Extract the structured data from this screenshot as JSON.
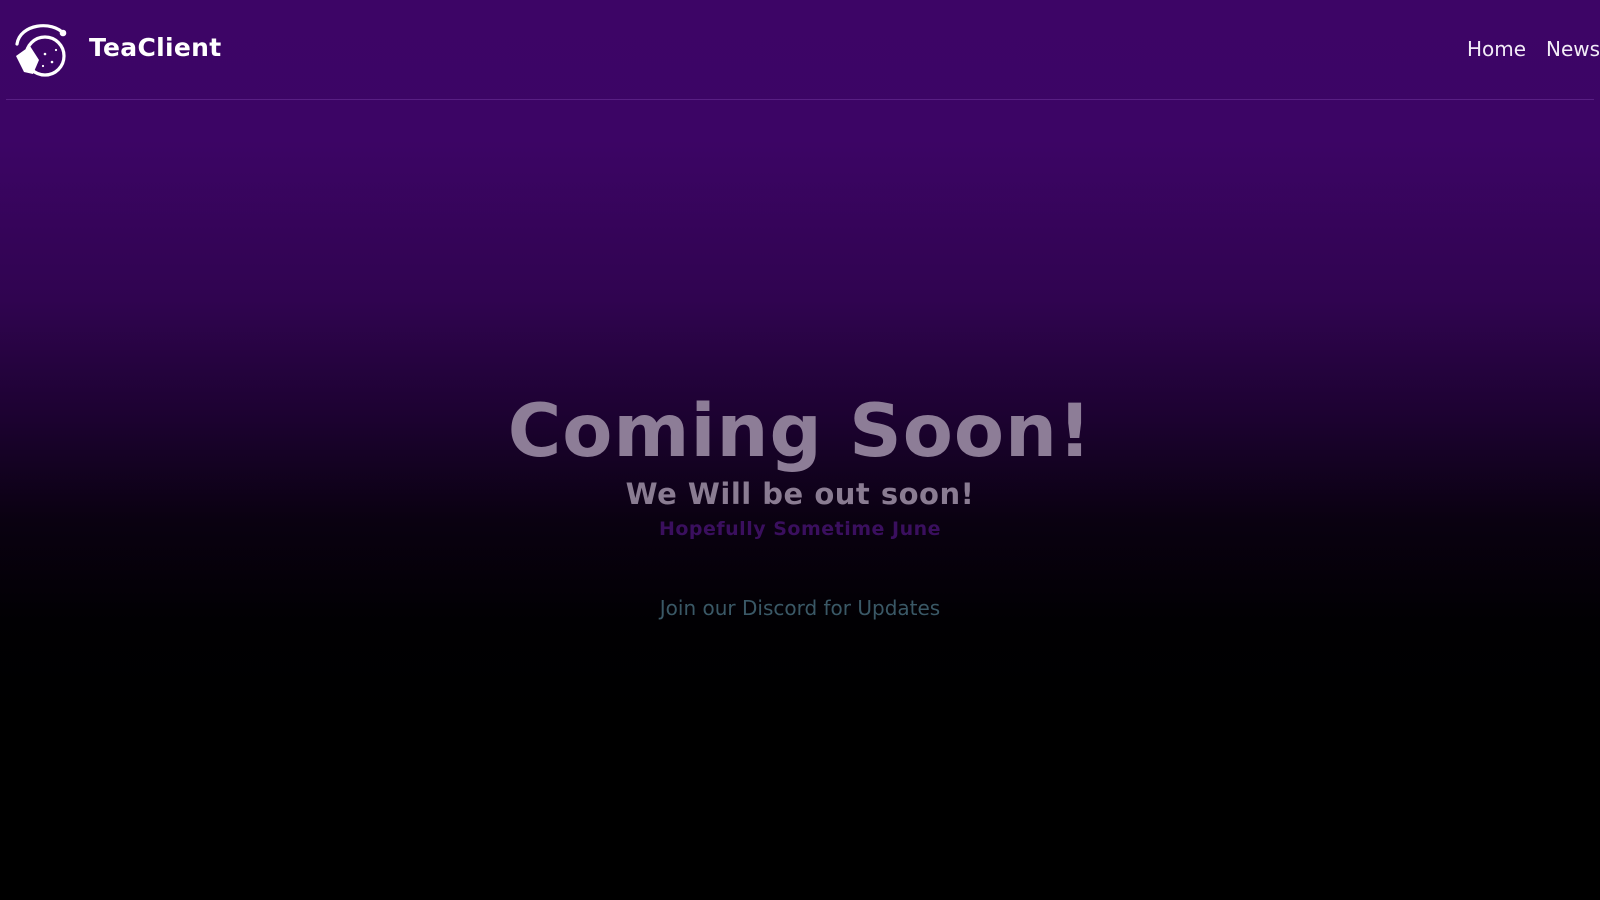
{
  "header": {
    "brand_name": "TeaClient",
    "nav": [
      {
        "label": "Home"
      },
      {
        "label": "News"
      }
    ]
  },
  "hero": {
    "title": "Coming Soon!",
    "subtitle": "We Will be out soon!",
    "note": "Hopefully Sometime June",
    "discord_link": "Join our Discord for Updates"
  },
  "icons": {
    "logo": "tea-cup-logo-icon"
  },
  "colors": {
    "background_top": "#3d0566",
    "background_bottom": "#000000",
    "title": "#8d7d97",
    "note": "#3a0f5e",
    "link": "#3a5866"
  }
}
